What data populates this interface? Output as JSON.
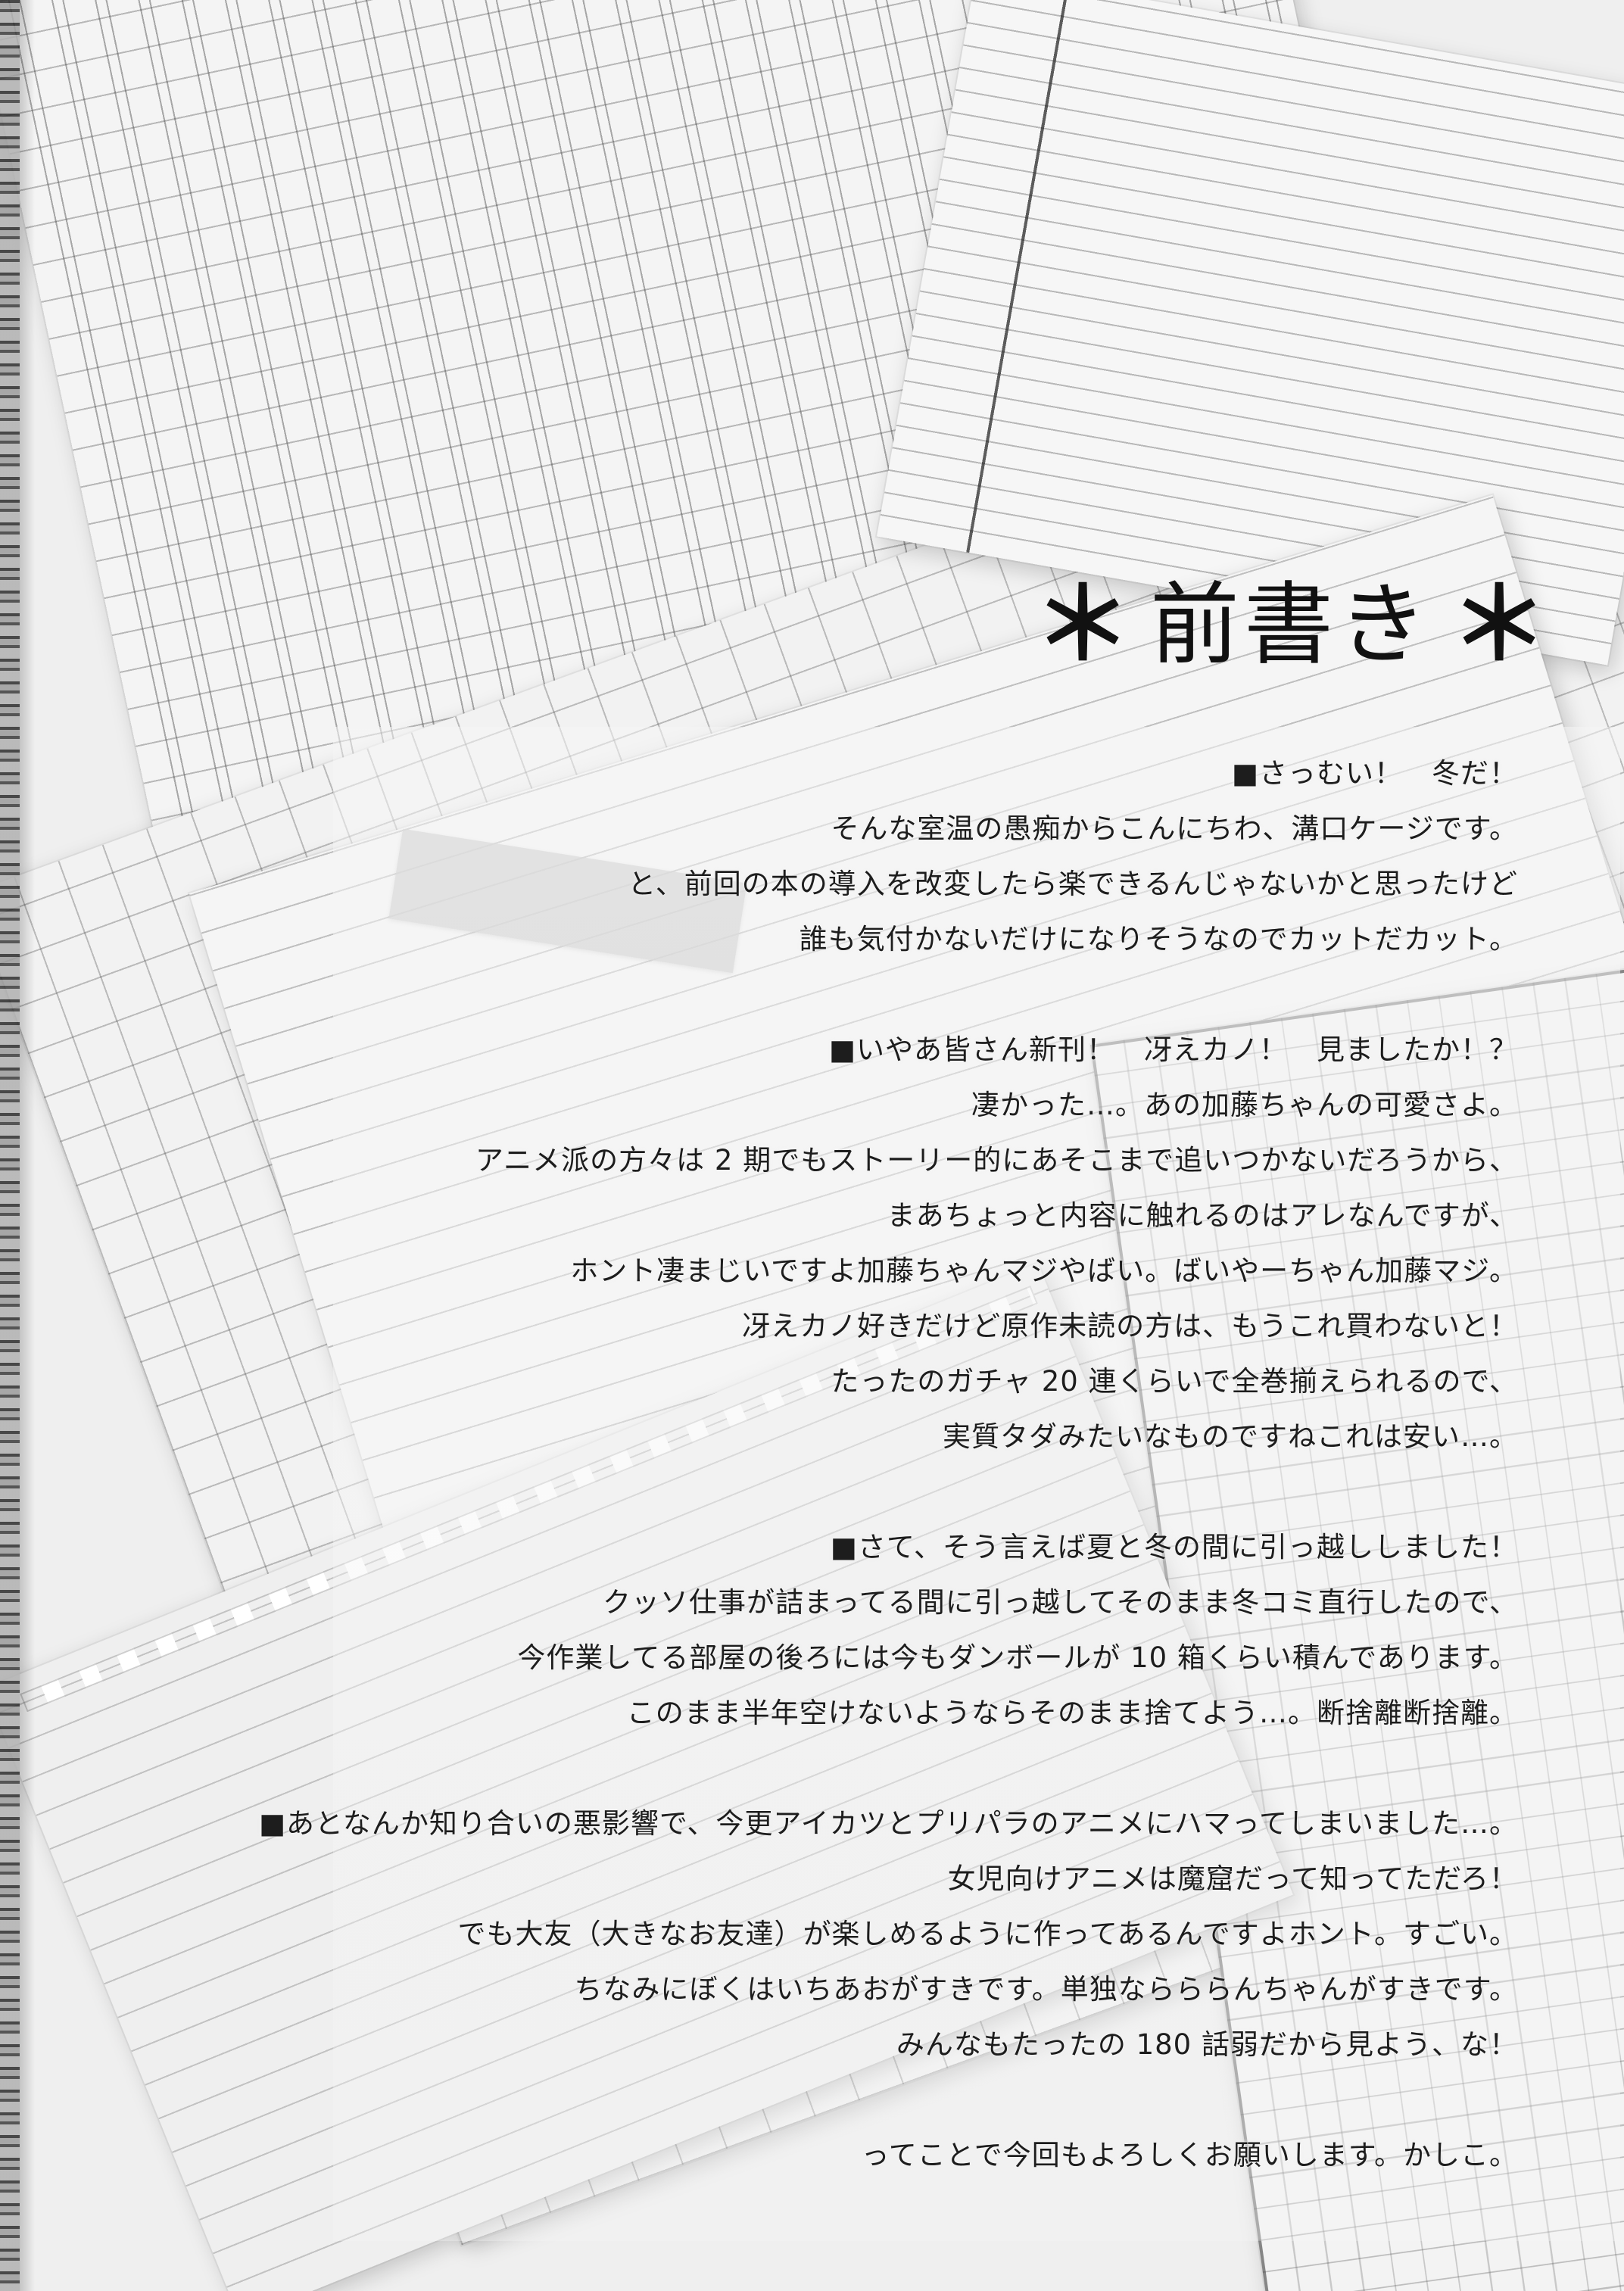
{
  "title": {
    "star_left": "＊",
    "text": "前書き",
    "star_right": "＊"
  },
  "paragraphs": [
    {
      "lines": [
        "■さっむい！　冬だ！",
        "そんな室温の愚痴からこんにちわ、溝口ケージです。",
        "と、前回の本の導入を改変したら楽できるんじゃないかと思ったけど",
        "誰も気付かないだけになりそうなのでカットだカット。"
      ]
    },
    {
      "lines": [
        "■いやあ皆さん新刊！　冴えカノ！　見ましたか！？",
        "凄かった…。あの加藤ちゃんの可愛さよ。",
        "アニメ派の方々は 2 期でもストーリー的にあそこまで追いつかないだろうから、",
        "まあちょっと内容に触れるのはアレなんですが、",
        "ホント凄まじいですよ加藤ちゃんマジやばい。ばいやーちゃん加藤マジ。",
        "冴えカノ好きだけど原作未読の方は、もうこれ買わないと！",
        "たったのガチャ 20 連くらいで全巻揃えられるので、",
        "実質タダみたいなものですねこれは安い…。"
      ]
    },
    {
      "lines": [
        "■さて、そう言えば夏と冬の間に引っ越ししました！",
        "クッソ仕事が詰まってる間に引っ越してそのまま冬コミ直行したので、",
        "今作業してる部屋の後ろには今もダンボールが 10 箱くらい積んであります。",
        "このまま半年空けないようならそのまま捨てよう…。断捨離断捨離。"
      ]
    },
    {
      "lines": [
        "■あとなんか知り合いの悪影響で、今更アイカツとプリパラのアニメにハマってしまいました…。",
        "女児向けアニメは魔窟だって知ってただろ！",
        "でも大友（大きなお友達）が楽しめるように作ってあるんですよホント。すごい。",
        "ちなみにぼくはいちあおがすきです。単独ならららんちゃんがすきです。",
        "みんなもたったの 180 話弱だから見よう、な！"
      ]
    },
    {
      "lines": [
        "ってことで今回もよろしくお願いします。かしこ。"
      ]
    }
  ]
}
